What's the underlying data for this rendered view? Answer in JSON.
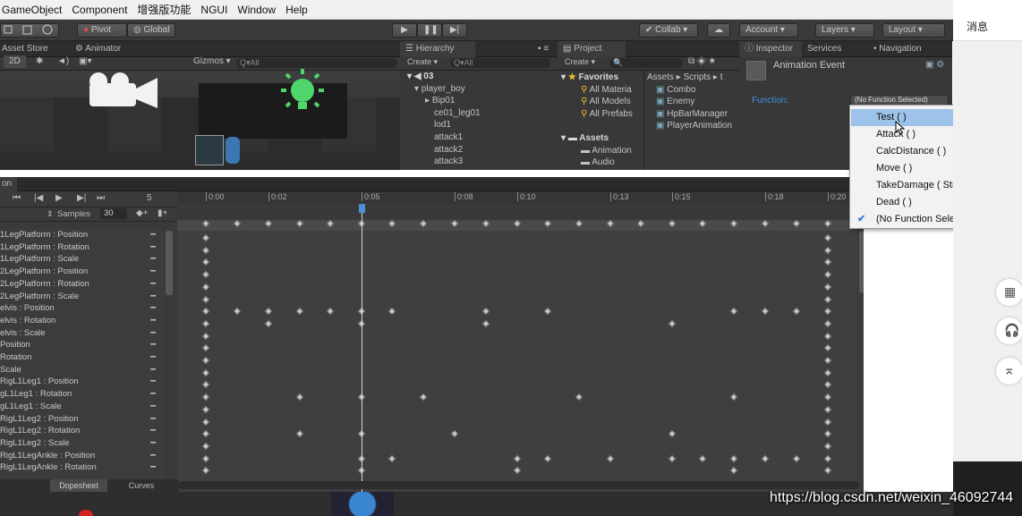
{
  "menu": [
    "GameObject",
    "Component",
    "增强版功能",
    "NGUI",
    "Window",
    "Help"
  ],
  "toolbar": {
    "pivot": "Pivot",
    "global": "Global",
    "collab": "Collab ▾",
    "account": "Account",
    "layers": "Layers",
    "layout": "Layout"
  },
  "scene": {
    "tabs": [
      "Asset Store",
      "Animator"
    ],
    "mode": "2D",
    "gizmos": "Gizmos ▾",
    "search_placeholder": "Q▾All"
  },
  "hierarchy": {
    "tab": "Hierarchy",
    "create": "Create ▾",
    "search_placeholder": "Q▾All",
    "scene": "03",
    "items": [
      "player_boy",
      "Bip01",
      "ce01_leg01",
      "lod1",
      "attack1",
      "attack2",
      "attack3"
    ]
  },
  "project": {
    "tab": "Project",
    "create": "Create ▾",
    "favorites_label": "Favorites",
    "favorites": [
      "All Materia",
      "All Models",
      "All Prefabs"
    ],
    "assets_label": "Assets",
    "assets": [
      "Animation",
      "Audio"
    ],
    "breadcrumb": [
      "Assets",
      "Scripts",
      "t"
    ],
    "scripts": [
      "Combo",
      "Enemy",
      "HpBarManager",
      "PlayerAnimation"
    ]
  },
  "inspector": {
    "tabs": [
      "Inspector",
      "Services",
      "Navigation"
    ],
    "title": "Animation Event",
    "function_label": "Function:",
    "function_value": "(No Function Selected)"
  },
  "dropdown": {
    "items": [
      "Test ( )",
      "Attack ( )",
      "CalcDistance ( )",
      "Move ( )",
      "TakeDamage ( String )",
      "Dead ( )",
      "(No Function Selected)"
    ],
    "highlighted": "Test ( )",
    "checked": "(No Function Selected)"
  },
  "animation": {
    "tab_label": "on",
    "frame": "5",
    "samples_label": "Samples",
    "samples": "30",
    "ruler_labels": [
      "0:00",
      "0:02",
      "0:05",
      "0:08",
      "0:10",
      "0:13",
      "0:15",
      "0:18",
      "0:20"
    ],
    "properties": [
      "1LegPlatform : Position",
      "1LegPlatform : Rotation",
      "1LegPlatform : Scale",
      "2LegPlatform : Position",
      "2LegPlatform : Rotation",
      "2LegPlatform : Scale",
      "elvis : Position",
      "elvis : Rotation",
      "elvis : Scale",
      " Position",
      " Rotation",
      " Scale",
      "RigL1Leg1 : Position",
      "gL1Leg1 : Rotation",
      "gL1Leg1 : Scale",
      "RigL1Leg2 : Position",
      "RigL1Leg2 : Rotation",
      "RigL1Leg2 : Scale",
      "RigL1LegAnkle : Position",
      "RigL1LegAnkle : Rotation"
    ],
    "bottom_tabs": [
      "Dopesheet",
      "Curves"
    ]
  },
  "side_panel": {
    "title": "消息"
  },
  "watermark": "https://blog.csdn.net/weixin_46092744"
}
